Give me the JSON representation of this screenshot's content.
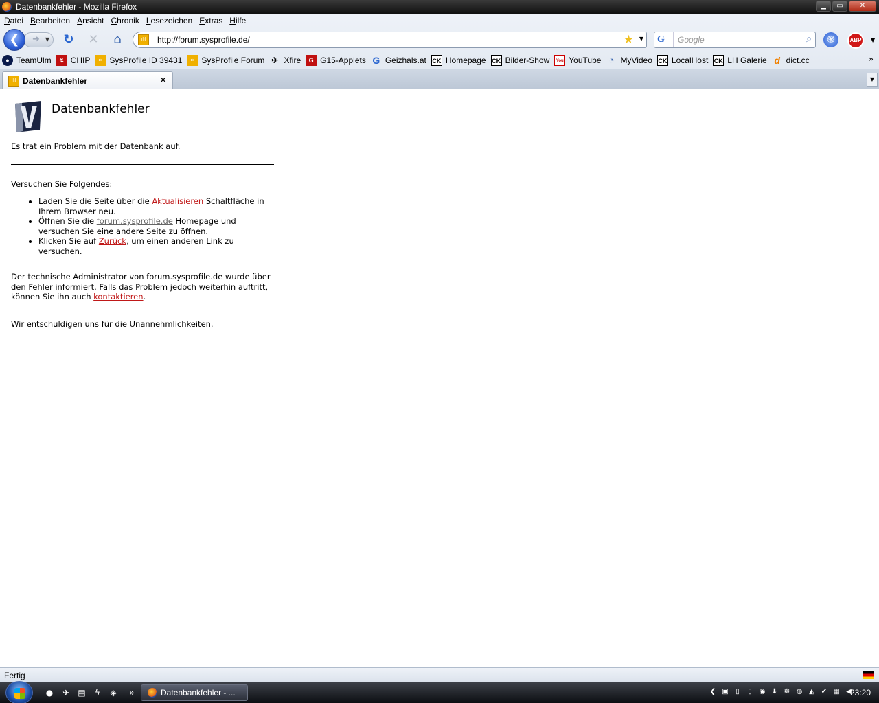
{
  "window": {
    "title": "Datenbankfehler - Mozilla Firefox",
    "controls": {
      "minimize": "▁",
      "maximize": "▭",
      "close": "✕"
    }
  },
  "menubar": [
    {
      "first": "D",
      "rest": "atei"
    },
    {
      "first": "B",
      "rest": "earbeiten"
    },
    {
      "first": "A",
      "rest": "nsicht"
    },
    {
      "first": "C",
      "rest": "hronik"
    },
    {
      "first": "L",
      "rest": "esezeichen"
    },
    {
      "first": "E",
      "rest": "xtras"
    },
    {
      "first": "H",
      "rest": "ilfe"
    }
  ],
  "navbar": {
    "url": "http://forum.sysprofile.de/",
    "search_placeholder": "Google",
    "search_engine": "G",
    "adblock": "ABP"
  },
  "bookmarks": [
    {
      "label": "TeamUlm",
      "icon": "teamulm-icon",
      "glyph": "●"
    },
    {
      "label": "CHIP",
      "icon": "chip-icon",
      "glyph": "↯"
    },
    {
      "label": "SysProfile ID 39431",
      "icon": "sysprofile-icon",
      "glyph": "ılıl"
    },
    {
      "label": "SysProfile Forum",
      "icon": "sysprofile-icon",
      "glyph": "ılıl"
    },
    {
      "label": "Xfire",
      "icon": "xfire-icon",
      "glyph": "✈"
    },
    {
      "label": "G15-Applets",
      "icon": "g15-icon",
      "glyph": "G"
    },
    {
      "label": "Geizhals.at",
      "icon": "geizhals-icon",
      "glyph": "G"
    },
    {
      "label": "Homepage",
      "icon": "ck-icon",
      "glyph": "CK"
    },
    {
      "label": "Bilder-Show",
      "icon": "ck-icon",
      "glyph": "CK"
    },
    {
      "label": "YouTube",
      "icon": "youtube-icon",
      "glyph": "You"
    },
    {
      "label": "MyVideo",
      "icon": "myvideo-icon",
      "glyph": "◔"
    },
    {
      "label": "LocalHost",
      "icon": "ck-icon",
      "glyph": "CK"
    },
    {
      "label": "LH Galerie",
      "icon": "ck-icon",
      "glyph": "CK"
    },
    {
      "label": "dict.cc",
      "icon": "dictcc-icon",
      "glyph": "d"
    }
  ],
  "tab": {
    "title": "Datenbankfehler"
  },
  "page": {
    "title": "Datenbankfehler",
    "intro": "Es trat ein Problem mit der Datenbank auf.",
    "try_heading": "Versuchen Sie Folgendes:",
    "tip1": {
      "pre": "Laden Sie die Seite über die ",
      "link": "Aktualisieren",
      "post": " Schaltfläche in Ihrem Browser neu."
    },
    "tip2": {
      "pre": "Öffnen Sie die ",
      "link": "forum.sysprofile.de",
      "post": " Homepage und versuchen Sie eine andere Seite zu öffnen."
    },
    "tip3": {
      "pre": "Klicken Sie auf ",
      "link": "Zurück",
      "post": ", um einen anderen Link zu versuchen."
    },
    "admin": {
      "pre": "Der technische Administrator von forum.sysprofile.de wurde über den Fehler informiert. Falls das Problem jedoch weiterhin auftritt, können Sie ihn auch ",
      "link": "kontaktieren",
      "post": "."
    },
    "sorry": "Wir entschuldigen uns für die Unannehmlichkeiten."
  },
  "statusbar": {
    "text": "Fertig"
  },
  "taskbar": {
    "task_label": "Datenbankfehler - ...",
    "clock": "23:20"
  }
}
